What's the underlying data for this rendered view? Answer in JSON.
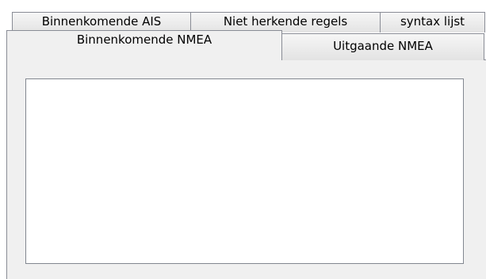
{
  "tabs": {
    "row_back": [
      {
        "label": "Binnenkomende AIS"
      },
      {
        "label": "Niet herkende regels"
      },
      {
        "label": "syntax lijst"
      }
    ],
    "row_front": [
      {
        "label": "Binnenkomende NMEA",
        "selected": true
      },
      {
        "label": "Uitgaande NMEA",
        "selected": false
      }
    ]
  },
  "panel": {
    "textarea_value": ""
  },
  "colors": {
    "panel_background": "#f0f0f0",
    "tab_border": "#898c95",
    "textarea_border": "#828790"
  }
}
